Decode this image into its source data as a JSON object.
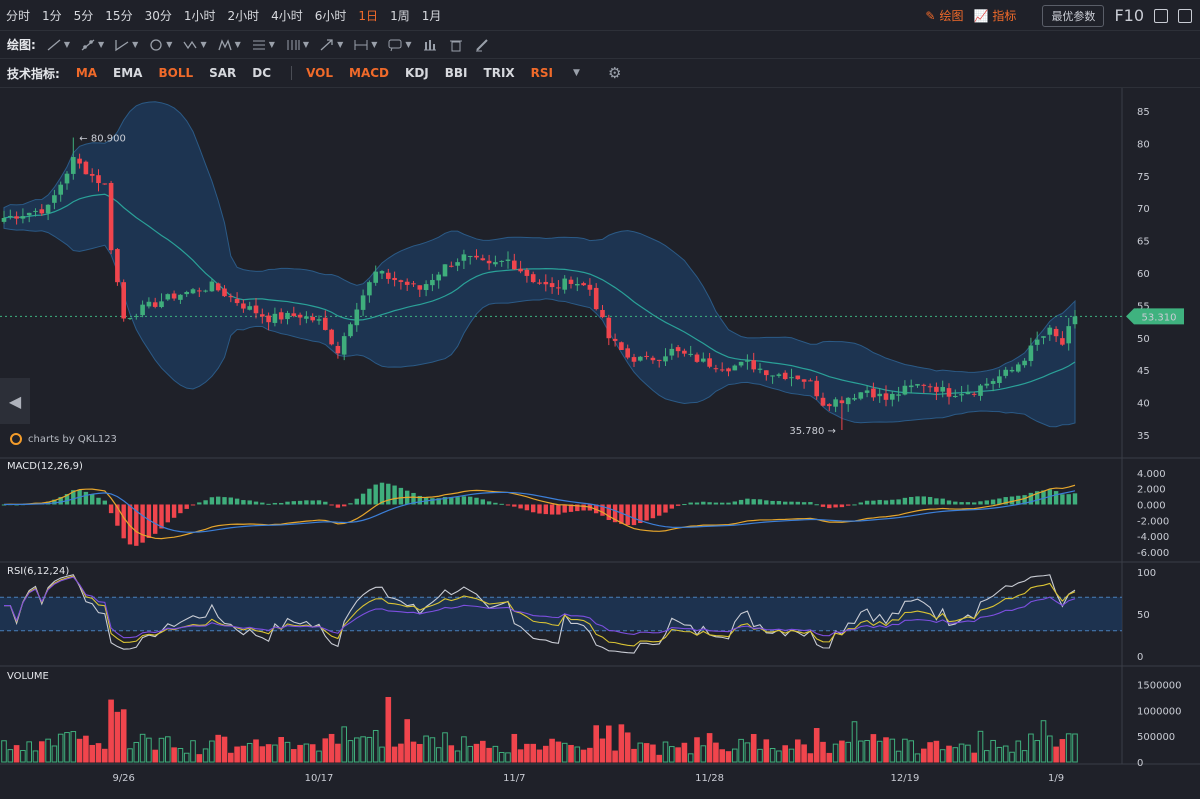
{
  "toolbar": {
    "periods": [
      "分时",
      "1分",
      "5分",
      "15分",
      "30分",
      "1小时",
      "2小时",
      "4小时",
      "6小时",
      "1日",
      "1周",
      "1月"
    ],
    "active_period": "1日",
    "draw_label": "绘图",
    "indicator_label": "指标",
    "params_button": "最优参数",
    "f10": "F10"
  },
  "draw_row": {
    "label": "绘图:"
  },
  "indicator_row": {
    "label": "技术指标:",
    "main_indicators": [
      {
        "name": "MA",
        "active": true
      },
      {
        "name": "EMA",
        "active": false
      },
      {
        "name": "BOLL",
        "active": true
      },
      {
        "name": "SAR",
        "active": false
      },
      {
        "name": "DC",
        "active": false
      }
    ],
    "sub_indicators": [
      {
        "name": "VOL",
        "active": true
      },
      {
        "name": "MACD",
        "active": true
      },
      {
        "name": "KDJ",
        "active": false
      },
      {
        "name": "BBI",
        "active": false
      },
      {
        "name": "TRIX",
        "active": false
      },
      {
        "name": "RSI",
        "active": true
      }
    ]
  },
  "branding": "charts by QKL123",
  "colors": {
    "up": "#3fae7c",
    "down": "#f0454d",
    "boll_fill": "#1d3b5f",
    "boll_line": "#2b5a86",
    "ma_line": "#2aa198",
    "macd_dif": "#e6a62c",
    "macd_dea": "#3c7fd8",
    "rsi6": "#c9ccd4",
    "rsi12": "#d9c334",
    "rsi24": "#7d4fe0",
    "price_tag": "#3fb27f",
    "accent": "#f06a2a"
  },
  "chart_data": {
    "type": "candlestick",
    "x_ticks": [
      "9/26",
      "10/17",
      "11/7",
      "11/28",
      "12/19",
      "1/9"
    ],
    "price_axis": {
      "ticks": [
        35,
        40,
        45,
        50,
        55,
        60,
        65,
        70,
        75,
        80,
        85
      ],
      "range": [
        33,
        87
      ]
    },
    "max_label": "80.900",
    "min_label": "35.780",
    "last_price": "53.310",
    "anchors": [
      [
        0,
        68.5
      ],
      [
        7,
        70
      ],
      [
        11,
        77.5
      ],
      [
        14,
        75
      ],
      [
        16,
        73.5
      ],
      [
        17,
        64
      ],
      [
        19,
        53
      ],
      [
        22,
        54.5
      ],
      [
        27,
        56.5
      ],
      [
        33,
        58
      ],
      [
        38,
        55
      ],
      [
        42,
        53
      ],
      [
        47,
        53.5
      ],
      [
        50,
        52.5
      ],
      [
        53,
        48
      ],
      [
        56,
        55
      ],
      [
        59,
        60
      ],
      [
        62,
        59
      ],
      [
        66,
        57.5
      ],
      [
        70,
        61
      ],
      [
        73,
        62.5
      ],
      [
        77,
        61
      ],
      [
        80,
        62
      ],
      [
        84,
        59
      ],
      [
        87,
        57.5
      ],
      [
        90,
        59
      ],
      [
        93,
        57.5
      ],
      [
        96,
        50
      ],
      [
        99,
        47
      ],
      [
        102,
        46.5
      ],
      [
        106,
        48
      ],
      [
        109,
        47
      ],
      [
        112,
        46
      ],
      [
        115,
        45.5
      ],
      [
        118,
        46
      ],
      [
        122,
        44.5
      ],
      [
        126,
        44
      ],
      [
        128,
        43
      ],
      [
        130,
        40
      ],
      [
        133,
        40.5
      ],
      [
        137,
        42
      ],
      [
        140,
        40.5
      ],
      [
        143,
        42
      ],
      [
        146,
        43
      ],
      [
        150,
        41.5
      ],
      [
        154,
        42
      ],
      [
        157,
        43.5
      ],
      [
        160,
        45
      ],
      [
        162,
        47
      ],
      [
        164,
        49.5
      ],
      [
        166,
        51
      ],
      [
        168,
        49
      ],
      [
        170,
        53.3
      ]
    ],
    "macd": {
      "title": "MACD(12,26,9)",
      "ticks": [
        "4.000",
        "2.000",
        "0.000",
        "-2.000",
        "-4.000",
        "-6.000"
      ],
      "range": [
        -7,
        4.6
      ]
    },
    "rsi": {
      "title": "RSI(6,12,24)",
      "ticks": [
        "100",
        "50",
        "0"
      ],
      "range": [
        0,
        100
      ],
      "bands": [
        70,
        30
      ]
    },
    "volume": {
      "title": "VOLUME",
      "ticks": [
        "1500000",
        "1000000",
        "500000",
        "0"
      ],
      "range": [
        0,
        1550000
      ]
    }
  }
}
